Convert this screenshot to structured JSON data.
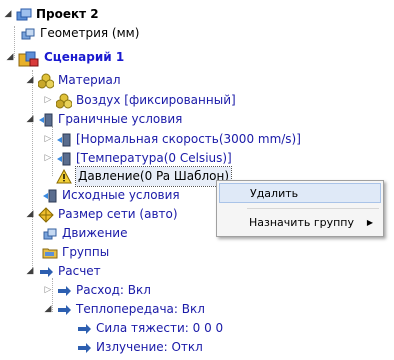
{
  "tree": {
    "project": "Проект 2",
    "geometry": "Геометрия (мм)",
    "scenario": "Сценарий 1",
    "material": "Материал",
    "air": "Воздух [фиксированный]",
    "boundary": "Граничные условия",
    "normal_speed": "[Нормальная скорость(3000 mm/s)]",
    "temperature": "[Температура(0 Celsius)]",
    "pressure": "Давление(0 Pa Шаблон)",
    "initial": "Исходные условия",
    "mesh": "Размер сети (авто)",
    "motion": "Движение",
    "groups": "Группы",
    "calc": "Расчет",
    "flow": "Расход: Вкл",
    "heat": "Теплопередача: Вкл",
    "gravity": "Сила тяжести: 0 0 0",
    "radiation": "Излучение: Откл"
  },
  "context_menu": {
    "delete": "Удалить",
    "assign_group": "Назначить группу"
  },
  "colors": {
    "link_blue": "#1a1aa8",
    "scenario_blue": "#1a1ad0",
    "menu_highlight": "#dfe9f7"
  }
}
